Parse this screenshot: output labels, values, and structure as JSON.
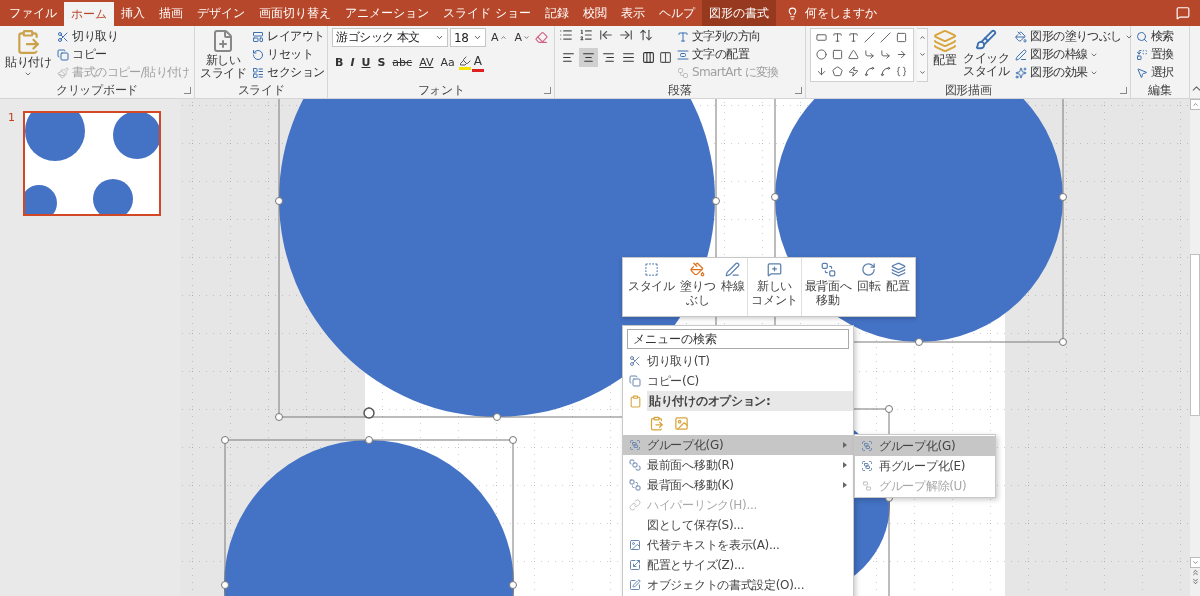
{
  "tabs": [
    {
      "label": "ファイル",
      "selected": false,
      "kind": "tab"
    },
    {
      "label": "ホーム",
      "selected": true,
      "kind": "tab"
    },
    {
      "label": "挿入",
      "selected": false,
      "kind": "tab"
    },
    {
      "label": "描画",
      "selected": false,
      "kind": "tab"
    },
    {
      "label": "デザイン",
      "selected": false,
      "kind": "tab"
    },
    {
      "label": "画面切り替え",
      "selected": false,
      "kind": "tab"
    },
    {
      "label": "アニメーション",
      "selected": false,
      "kind": "tab"
    },
    {
      "label": "スライド ショー",
      "selected": false,
      "kind": "tab"
    },
    {
      "label": "記録",
      "selected": false,
      "kind": "tab"
    },
    {
      "label": "校閲",
      "selected": false,
      "kind": "tab"
    },
    {
      "label": "表示",
      "selected": false,
      "kind": "tab"
    },
    {
      "label": "ヘルプ",
      "selected": false,
      "kind": "tab"
    },
    {
      "label": "図形の書式",
      "selected": false,
      "kind": "contextual"
    }
  ],
  "tell_me": "何をしますか",
  "ribbon": {
    "clipboard": {
      "label": "クリップボード",
      "paste": "貼り付け",
      "commands": [
        {
          "label": "切り取り",
          "disabled": false
        },
        {
          "label": "コピー",
          "disabled": false
        },
        {
          "label": "書式のコピー/貼り付け",
          "disabled": true
        }
      ]
    },
    "slides": {
      "label": "スライド",
      "new_slide": [
        "新しい",
        "スライド"
      ],
      "commands": [
        "レイアウト",
        "リセット",
        "セクション"
      ]
    },
    "font": {
      "label": "フォント",
      "font_name": "游ゴシック 本文",
      "font_size": "18",
      "grow": "A",
      "shrink": "A",
      "styles": [
        "B",
        "I",
        "U",
        "S",
        "abc",
        "AV",
        "Aa"
      ],
      "color_letter": "A"
    },
    "paragraph": {
      "label": "段落",
      "alignments": [
        {
          "selected": false
        },
        {
          "selected": true
        },
        {
          "selected": false
        },
        {
          "selected": false
        },
        {
          "selected": false
        }
      ],
      "commands": [
        {
          "label": "文字列の方向",
          "disabled": false
        },
        {
          "label": "文字の配置",
          "disabled": false
        },
        {
          "label": "SmartArt に変換",
          "disabled": true
        }
      ]
    },
    "drawing": {
      "label": "図形描画",
      "arrange": "配置",
      "quick_style": [
        "クイック",
        "スタイル"
      ],
      "commands": [
        "図形の塗りつぶし",
        "図形の枠線",
        "図形の効果"
      ]
    },
    "editing": {
      "label": "編集",
      "commands": [
        "検索",
        "置換",
        "選択"
      ]
    }
  },
  "thumbnails": [
    {
      "number": "1",
      "selected": true
    }
  ],
  "mini_toolbar": [
    {
      "lines": [
        "スタイル"
      ]
    },
    {
      "lines": [
        "塗りつ",
        "ぶし"
      ]
    },
    {
      "lines": [
        "枠線"
      ]
    },
    {
      "lines": [
        "新しい",
        "コメント"
      ]
    },
    {
      "lines": [
        "最背面へ",
        "移動"
      ]
    },
    {
      "lines": [
        "回転"
      ]
    },
    {
      "lines": [
        "配置"
      ]
    }
  ],
  "context_menu": {
    "search_placeholder": "メニューの検索",
    "items": [
      {
        "kind": "item",
        "label": "切り取り(T)",
        "disabled": false,
        "selected": false,
        "submenu": false
      },
      {
        "kind": "item",
        "label": "コピー(C)",
        "disabled": false,
        "selected": false,
        "submenu": false
      },
      {
        "kind": "header",
        "label": "貼り付けのオプション:"
      },
      {
        "kind": "paste_options"
      },
      {
        "kind": "item",
        "label": "グループ化(G)",
        "disabled": false,
        "selected": true,
        "submenu": true
      },
      {
        "kind": "item",
        "label": "最前面へ移動(R)",
        "disabled": false,
        "selected": false,
        "submenu": true
      },
      {
        "kind": "item",
        "label": "最背面へ移動(K)",
        "disabled": false,
        "selected": false,
        "submenu": true
      },
      {
        "kind": "item",
        "label": "ハイパーリンク(H)...",
        "disabled": true,
        "selected": false,
        "submenu": false
      },
      {
        "kind": "item",
        "label": "図として保存(S)...",
        "disabled": false,
        "selected": false,
        "submenu": false
      },
      {
        "kind": "item",
        "label": "代替テキストを表示(A)...",
        "disabled": false,
        "selected": false,
        "submenu": false
      },
      {
        "kind": "item",
        "label": "配置とサイズ(Z)...",
        "disabled": false,
        "selected": false,
        "submenu": false
      },
      {
        "kind": "item",
        "label": "オブジェクトの書式設定(O)...",
        "disabled": false,
        "selected": false,
        "submenu": false
      }
    ]
  },
  "submenu": {
    "items": [
      {
        "label": "グループ化(G)",
        "selected": true,
        "disabled": false
      },
      {
        "label": "再グループ化(E)",
        "selected": false,
        "disabled": false
      },
      {
        "label": "グループ解除(U)",
        "selected": false,
        "disabled": true
      }
    ]
  }
}
